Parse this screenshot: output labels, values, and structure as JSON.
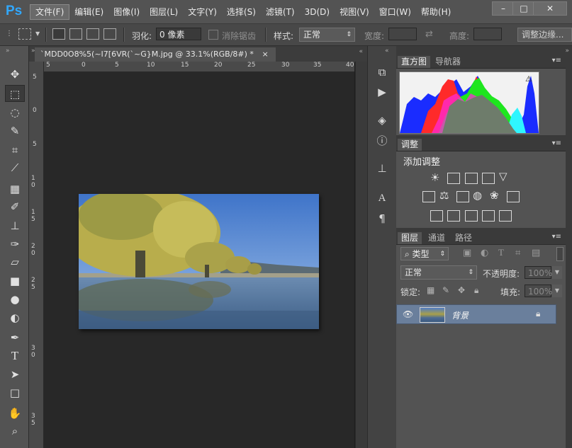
{
  "app": {
    "logo": "Ps"
  },
  "menu": [
    {
      "label": "文件(F)"
    },
    {
      "label": "编辑(E)"
    },
    {
      "label": "图像(I)"
    },
    {
      "label": "图层(L)"
    },
    {
      "label": "文字(Y)"
    },
    {
      "label": "选择(S)"
    },
    {
      "label": "滤镜(T)"
    },
    {
      "label": "3D(D)"
    },
    {
      "label": "视图(V)"
    },
    {
      "label": "窗口(W)"
    },
    {
      "label": "帮助(H)"
    }
  ],
  "window_controls": {
    "minimize": "–",
    "maximize": "□",
    "close": "✕"
  },
  "options": {
    "feather_label": "羽化:",
    "feather_value": "0 像素",
    "antialias_label": "消除锯齿",
    "style_label": "样式:",
    "style_value": "正常",
    "width_label": "宽度:",
    "height_label": "高度:",
    "refine_edge_button": "调整边缘..."
  },
  "document": {
    "tab_title": "`MDD0O8%5(~I7[6VR(`~G}M.jpg @ 33.1%(RGB/8#) *",
    "close_label": "×",
    "ruler_top": [
      "5",
      "0",
      "5",
      "10",
      "15",
      "20",
      "25",
      "30",
      "35",
      "40"
    ],
    "ruler_left": [
      "5",
      "0",
      "5",
      "1 0",
      "1 5",
      "2 0",
      "2 5",
      "3 0",
      "3 5"
    ]
  },
  "tools": [
    {
      "icon": "move-icon",
      "glyph": "✥"
    },
    {
      "icon": "marquee-icon",
      "glyph": "⬚"
    },
    {
      "icon": "lasso-icon",
      "glyph": "◌"
    },
    {
      "icon": "quick-select-icon",
      "glyph": "✎"
    },
    {
      "icon": "crop-icon",
      "glyph": "⌗"
    },
    {
      "icon": "eyedropper-icon",
      "glyph": "⟋"
    },
    {
      "icon": "healing-icon",
      "glyph": "▦"
    },
    {
      "icon": "brush-icon",
      "glyph": "✐"
    },
    {
      "icon": "stamp-icon",
      "glyph": "⊥"
    },
    {
      "icon": "history-brush-icon",
      "glyph": "✑"
    },
    {
      "icon": "eraser-icon",
      "glyph": "▱"
    },
    {
      "icon": "gradient-icon",
      "glyph": "■"
    },
    {
      "icon": "blur-icon",
      "glyph": "●"
    },
    {
      "icon": "dodge-icon",
      "glyph": "◐"
    },
    {
      "icon": "pen-icon",
      "glyph": "✒"
    },
    {
      "icon": "type-icon",
      "glyph": "T"
    },
    {
      "icon": "path-select-icon",
      "glyph": "➤"
    },
    {
      "icon": "shape-icon",
      "glyph": "□"
    },
    {
      "icon": "hand-icon",
      "glyph": "✋"
    },
    {
      "icon": "zoom-icon",
      "glyph": "⌕"
    }
  ],
  "panels": {
    "histogram_tabs": [
      "直方图",
      "导航器"
    ],
    "adjust_tab": "调整",
    "adjust_title": "添加调整",
    "layers_tabs": [
      "图层",
      "通道",
      "路径"
    ],
    "filter_kind": "类型",
    "blend_mode": "正常",
    "opacity_label": "不透明度:",
    "opacity_value": "100%",
    "lock_label": "锁定:",
    "fill_label": "填充:",
    "fill_value": "100%",
    "layer_name": "背景"
  }
}
